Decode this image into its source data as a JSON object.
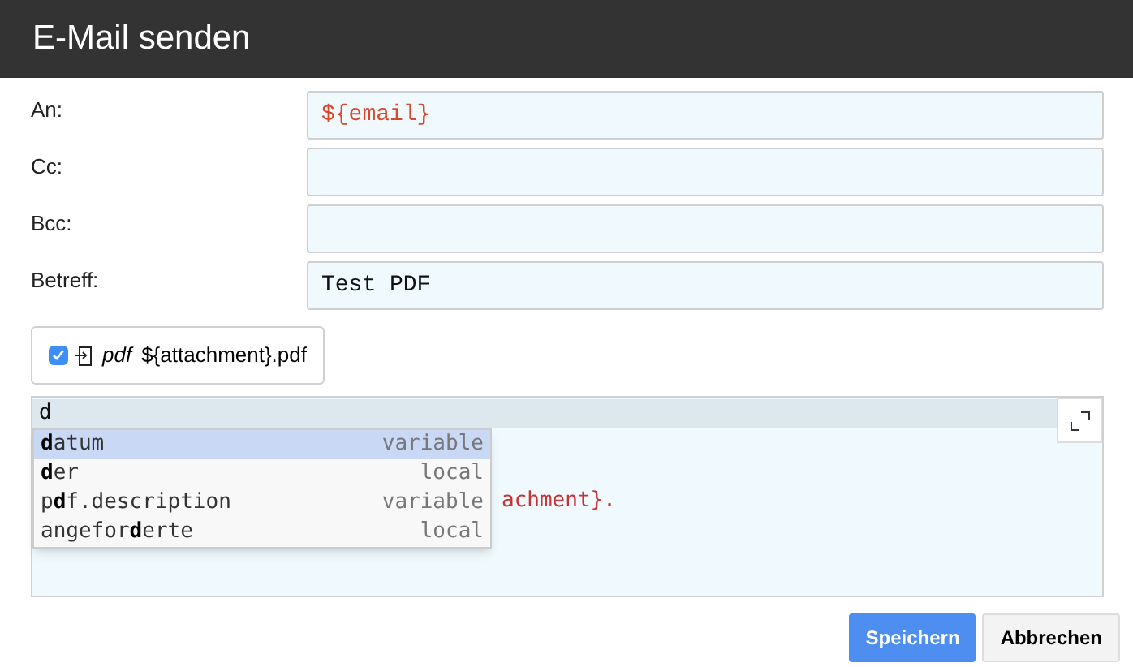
{
  "window": {
    "title": "E-Mail senden"
  },
  "fields": [
    {
      "label": "An:",
      "value": "${email}",
      "kind": "template"
    },
    {
      "label": "Cc:"
    },
    {
      "label": "Bcc:"
    },
    {
      "label": "Betreff:",
      "value": "Test PDF",
      "kind": "plain"
    }
  ],
  "attachment": {
    "checked": true,
    "type": "pdf",
    "name": "${attachment}.pdf"
  },
  "editor": {
    "lines": [
      {
        "text": "d",
        "active": true
      },
      {
        "active": false
      },
      {
        "active": false
      },
      {
        "text": "achment}.",
        "active": false
      }
    ],
    "autocomplete": [
      {
        "label": "**d**atum",
        "kind": "variable",
        "selected": true
      },
      {
        "label": "**d**er",
        "kind": "local",
        "selected": false
      },
      {
        "label": "p**d**f.description",
        "kind": "variable",
        "selected": false
      },
      {
        "label": "angefor**d**erte",
        "kind": "local",
        "selected": false
      }
    ]
  },
  "buttons": [
    {
      "label": "Speichern",
      "kind": "primary"
    },
    {
      "label": "Abbrechen",
      "kind": "secondary"
    }
  ]
}
